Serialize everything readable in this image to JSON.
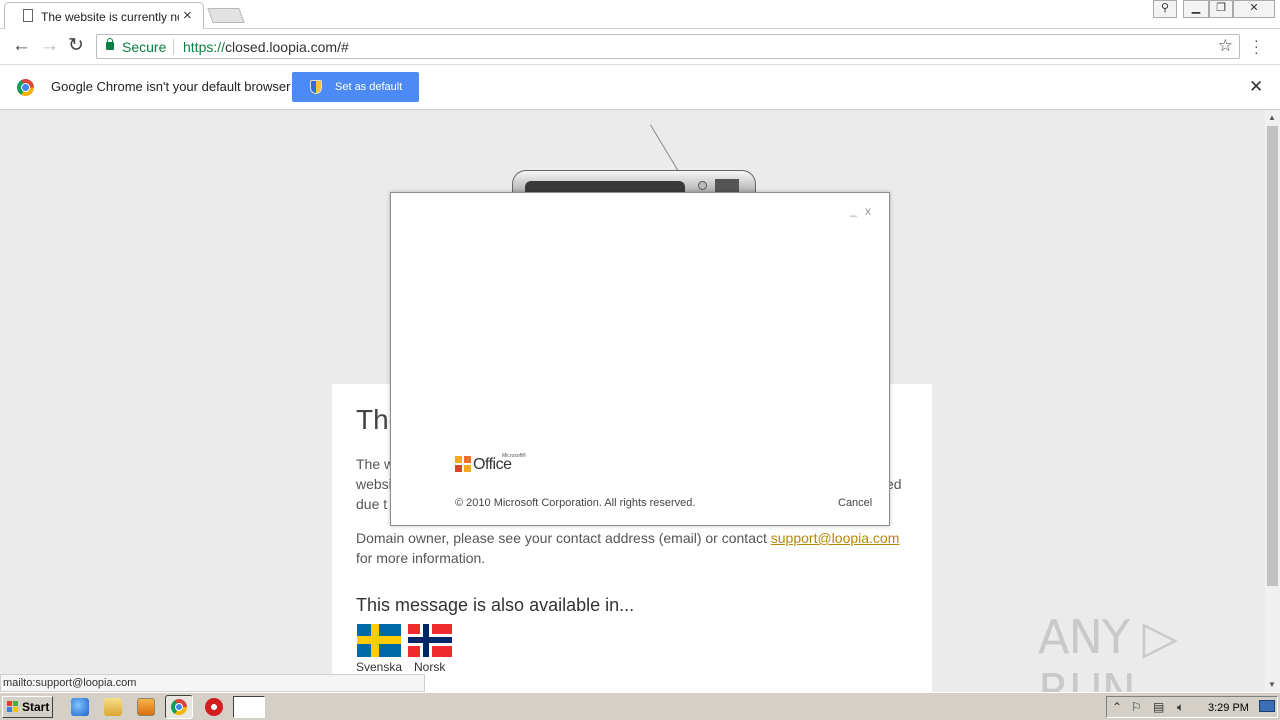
{
  "browser": {
    "tab_title": "The website is currently not",
    "tab_close": "×",
    "url_scheme": "https://",
    "url_rest": "closed.loopia.com/#",
    "secure_label": "Secure",
    "status_url": "mailto:support@loopia.com"
  },
  "infobar": {
    "message": "Google Chrome isn't your default browser",
    "button": "Set as default",
    "close": "✕"
  },
  "page": {
    "heading_visible": "The",
    "p1_lines": [
      "The w",
      "websi",
      "due t"
    ],
    "p1_tail": "ed",
    "p2_text": "Domain owner, please see your contact address (email) or contact ",
    "p2_link": "support@loopia.com",
    "p2_end": " for more information.",
    "languages_heading": "This message is also available in...",
    "languages": [
      {
        "label": "Svenska"
      },
      {
        "label": "Norsk"
      }
    ]
  },
  "splash": {
    "minimize": "_",
    "close": "x",
    "logo_small": "Microsoft®",
    "logo_word": "Office",
    "copyright": "© 2010 Microsoft Corporation.  All rights reserved.",
    "cancel": "Cancel"
  },
  "watermark": "ANY ▷ RUN",
  "taskbar": {
    "start": "Start",
    "clock": "3:29 PM"
  }
}
